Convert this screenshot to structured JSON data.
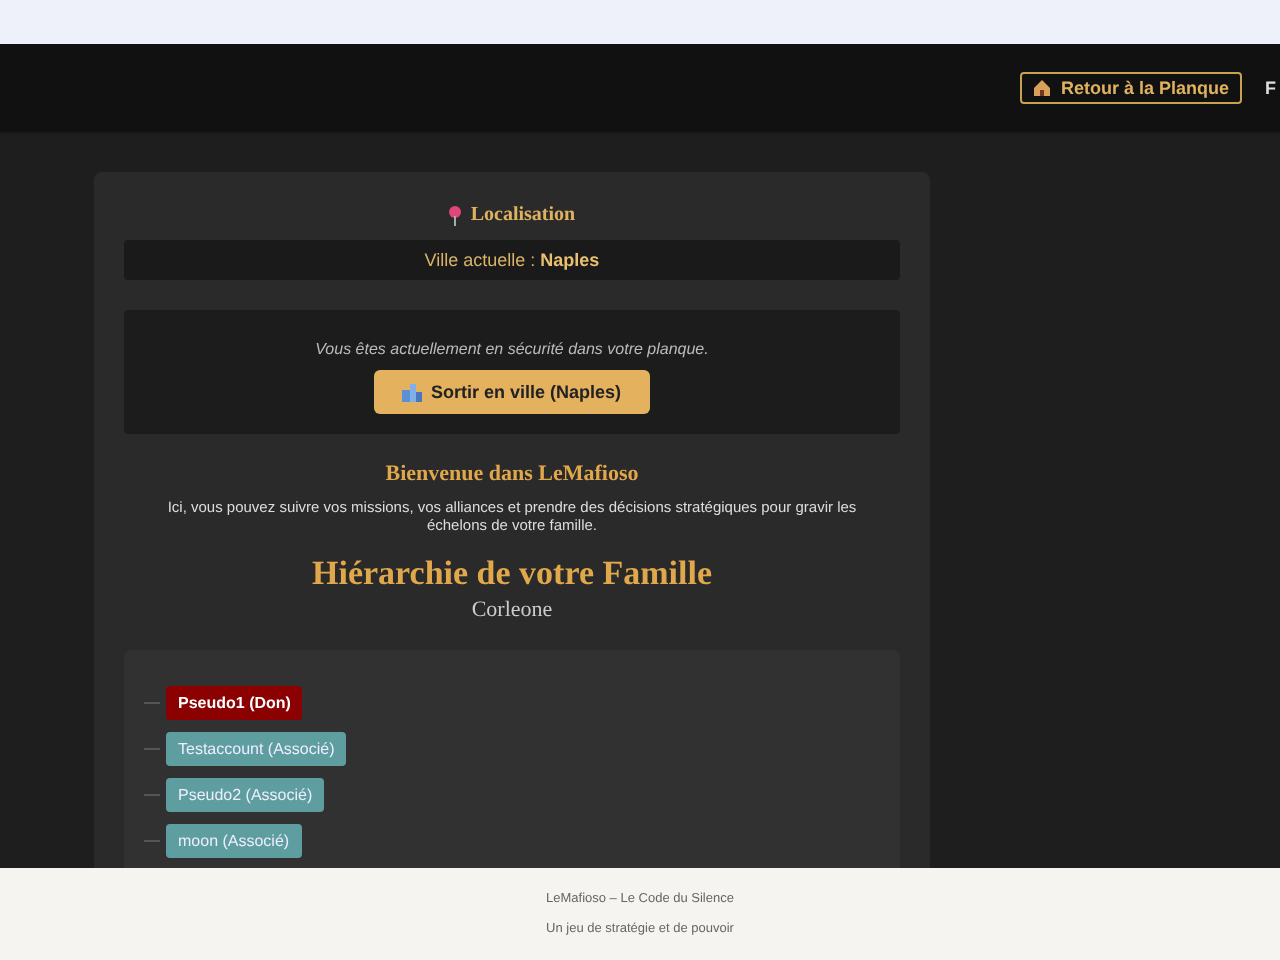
{
  "header": {
    "home_button": "Retour à la Planque",
    "nav_cut": "F"
  },
  "location": {
    "title": "Localisation",
    "city_label": "Ville actuelle : ",
    "city": "Naples"
  },
  "safehouse": {
    "message": "Vous êtes actuellement en sécurité dans votre planque.",
    "button": "Sortir en ville (Naples)"
  },
  "welcome": {
    "title": "Bienvenue dans LeMafioso",
    "text": "Ici, vous pouvez suivre vos missions, vos alliances et prendre des décisions stratégiques pour gravir les échelons de votre famille."
  },
  "hierarchy": {
    "title": "Hiérarchie de votre Famille",
    "family": "Corleone",
    "members": [
      {
        "label": "Pseudo1 (Don)",
        "kind": "don"
      },
      {
        "label": "Testaccount (Associé)",
        "kind": "associate"
      },
      {
        "label": "Pseudo2 (Associé)",
        "kind": "associate"
      },
      {
        "label": "moon (Associé)",
        "kind": "associate"
      }
    ]
  },
  "footer": {
    "line1": "LeMafioso – Le Code du Silence",
    "line2": "Un jeu de stratégie et de pouvoir"
  }
}
